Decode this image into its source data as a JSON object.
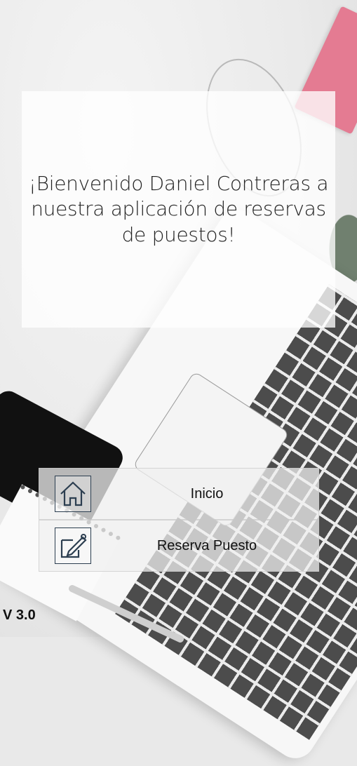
{
  "welcome": {
    "message": "¡Bienvenido Daniel Contreras a nuestra aplicación de reservas de puestos!"
  },
  "menu": {
    "items": [
      {
        "label": "Inicio",
        "icon": "home-icon"
      },
      {
        "label": "Reserva Puesto",
        "icon": "edit-note-icon"
      }
    ]
  },
  "footer": {
    "version": "V 3.0"
  },
  "colors": {
    "icon_stroke": "#2c3e50",
    "text": "#111111"
  }
}
